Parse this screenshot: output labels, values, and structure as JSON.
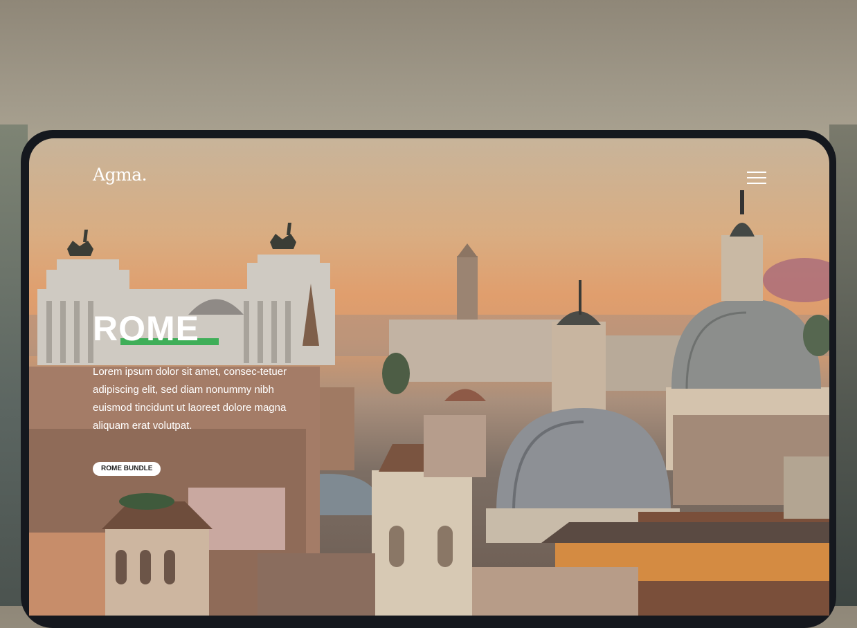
{
  "brand": {
    "logo_text": "Agma."
  },
  "nav": {
    "menu_icon": "hamburger-menu-icon"
  },
  "hero": {
    "title": "ROME",
    "body": "Lorem ipsum dolor sit amet, consec-tetuer adipiscing elit, sed diam nonummy nibh euismod tincidunt ut laoreet dolore magna aliquam erat volutpat.",
    "button_label": "ROME BUNDLE",
    "accent_color": "#3fae58"
  },
  "background": {
    "image_subject": "Rome city skyline at sunset with domes"
  }
}
